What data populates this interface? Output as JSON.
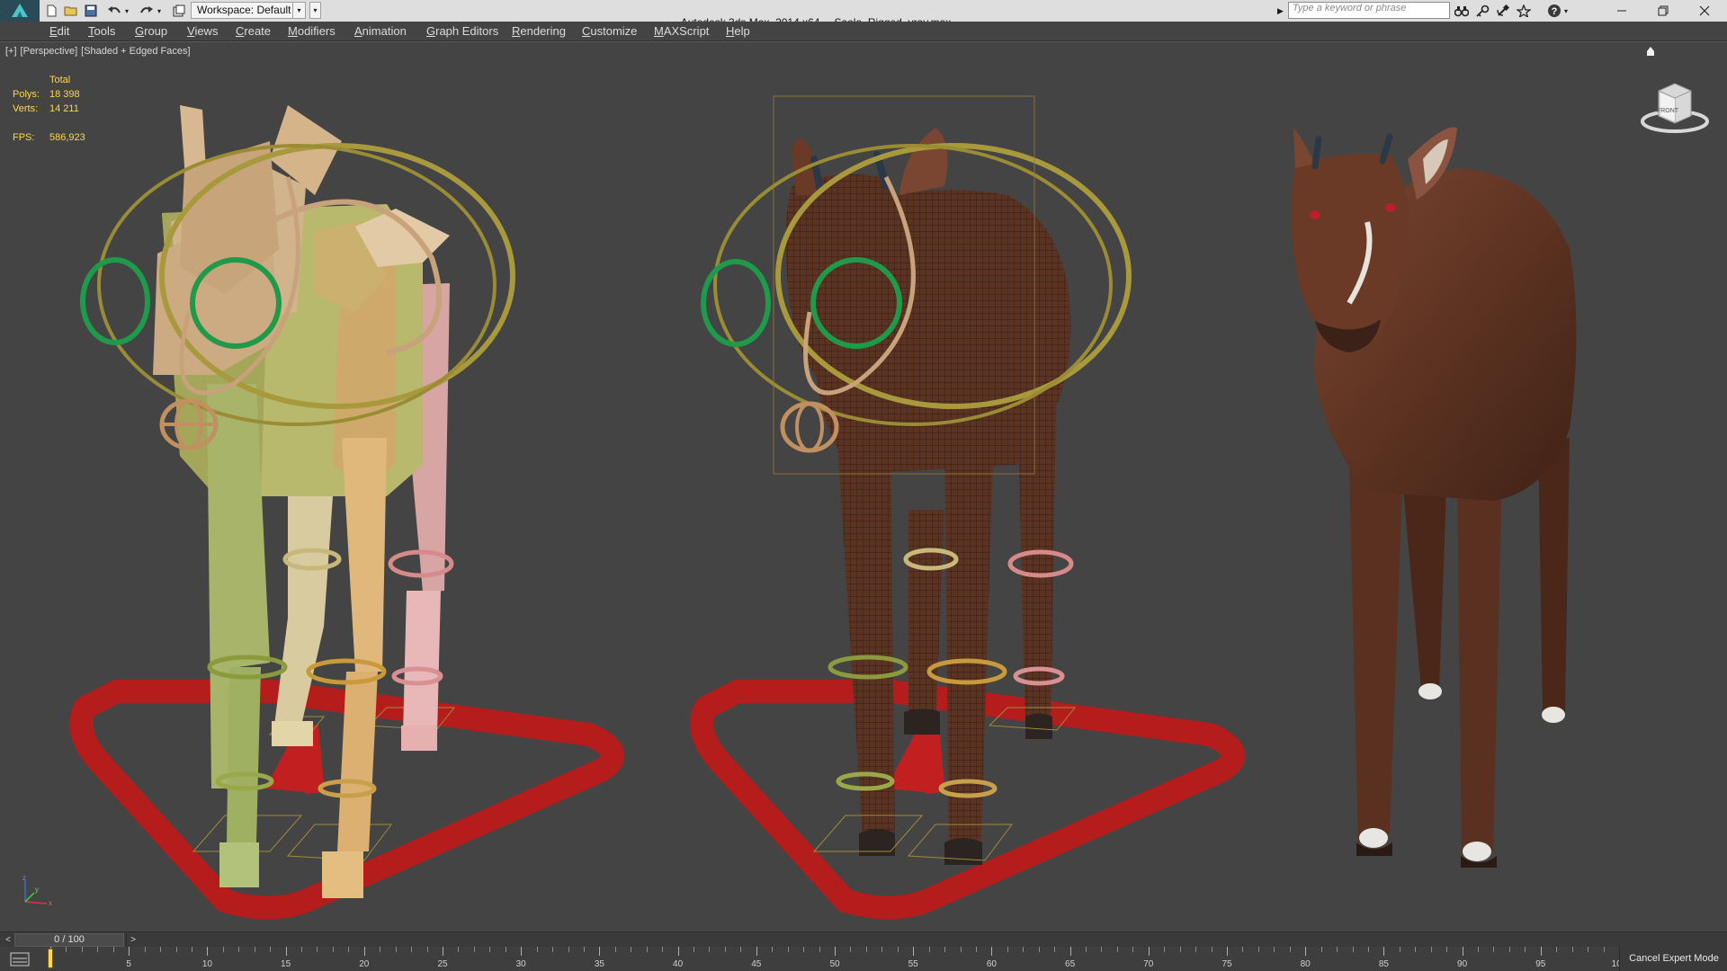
{
  "titlebar": {
    "workspace_label": "Workspace: Default",
    "app_title": "Autodesk 3ds Max  2014 x64",
    "file_name": "Saola_Rigged_vray.max",
    "search_placeholder": "Type a keyword or phrase"
  },
  "menu": {
    "items": [
      "Edit",
      "Tools",
      "Group",
      "Views",
      "Create",
      "Modifiers",
      "Animation",
      "Graph Editors",
      "Rendering",
      "Customize",
      "MAXScript",
      "Help"
    ]
  },
  "viewport": {
    "label_plus": "[+]",
    "label_view": "[Perspective]",
    "label_shading": "[Shaded + Edged Faces]",
    "stats": {
      "header": "Total",
      "polys_label": "Polys:",
      "polys_value": "18 398",
      "verts_label": "Verts:",
      "verts_value": "14 211",
      "fps_label": "FPS:",
      "fps_value": "586,923"
    },
    "viewcube_label": "FRONT",
    "axis": {
      "x": "x",
      "y": "y",
      "z": "z"
    }
  },
  "timeslider": {
    "position_text": "0 / 100",
    "prev": "<",
    "next": ">"
  },
  "trackbar": {
    "ticks": [
      "0",
      "5",
      "10",
      "15",
      "20",
      "25",
      "30",
      "35",
      "40",
      "45",
      "50",
      "55",
      "60",
      "65",
      "70",
      "75",
      "80",
      "85",
      "90",
      "95",
      "100"
    ],
    "current_frame": 0
  },
  "status": {
    "cancel_expert": "Cancel Expert Mode"
  },
  "colors": {
    "viewport_bg": "#444444",
    "stats_text": "#ffd84a",
    "control_red": "#b51c1c",
    "control_green": "#1e9a4a",
    "control_gold": "#a89a3c",
    "saola_brown": "#6a3a26"
  }
}
